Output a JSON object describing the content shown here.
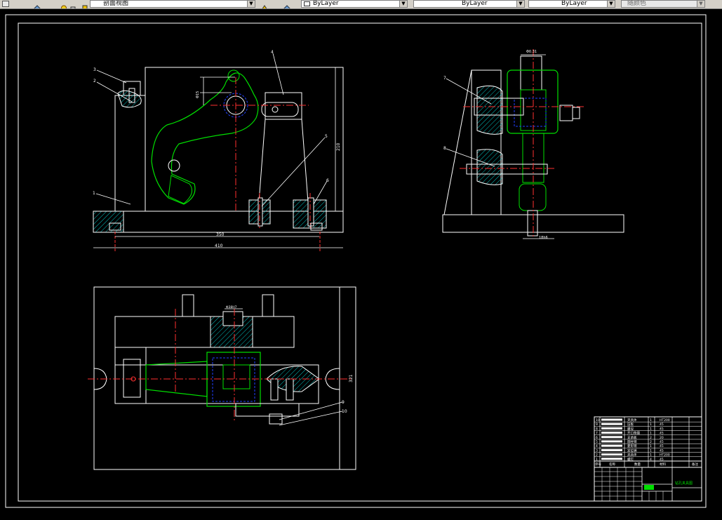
{
  "toolbar": {
    "named_view": "剖面视图",
    "color_control": "ByLayer",
    "linetype_control": "ByLayer",
    "lineweight_control": "ByLayer",
    "plot_style": "随颜色"
  },
  "drawing": {
    "front_view": {
      "dim_width": "350",
      "dim_overall": "410",
      "dim_height": "210",
      "dim_hole": "Φ15",
      "labels": [
        "1",
        "2",
        "3",
        "4",
        "5",
        "6"
      ]
    },
    "side_view": {
      "dim_top": "Φ0.31",
      "dim_bottom": "18h6",
      "labels": [
        "7",
        "8"
      ]
    },
    "top_view": {
      "dim_slot": "Φ38H7",
      "dim_right": "321",
      "labels": [
        "9",
        "10"
      ]
    },
    "title_block": {
      "seq": [
        "1",
        "2",
        "3",
        "4",
        "5",
        "6",
        "7",
        "8",
        "9",
        "10"
      ],
      "parts": [
        "螺钉",
        "夹具体",
        "定位销",
        "菱形销",
        "圆柱销",
        "支承板",
        "开口垫圈",
        "螺母",
        "压板",
        "夹具体"
      ],
      "qty": [
        "4",
        "1",
        "1",
        "1",
        "2",
        "2",
        "1",
        "1",
        "1",
        "1"
      ],
      "material": [
        "45",
        "HT200",
        "45",
        "45",
        "45",
        "20",
        "45",
        "45",
        "45",
        "HT200"
      ],
      "header": [
        "序号",
        "名称",
        "数量",
        "材料",
        "备注"
      ],
      "title": "钻孔夹具图"
    }
  }
}
